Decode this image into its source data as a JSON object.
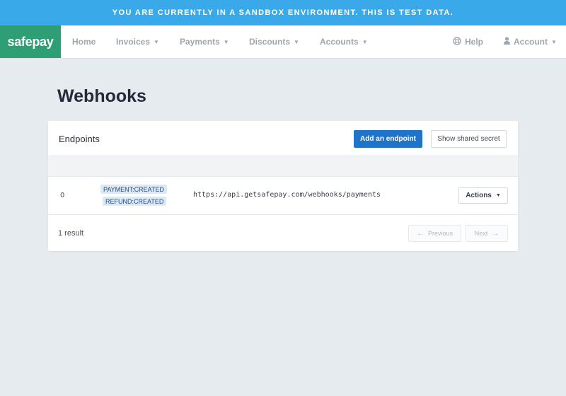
{
  "banner": {
    "text": "YOU ARE CURRENTLY IN A SANDBOX ENVIRONMENT. THIS IS TEST DATA."
  },
  "nav": {
    "logo": "safepay",
    "items": [
      {
        "label": "Home"
      },
      {
        "label": "Invoices"
      },
      {
        "label": "Payments"
      },
      {
        "label": "Discounts"
      },
      {
        "label": "Accounts"
      }
    ],
    "help": "Help",
    "account": "Account"
  },
  "page": {
    "title": "Webhooks"
  },
  "endpoints": {
    "title": "Endpoints",
    "add_button": "Add an endpoint",
    "secret_button": "Show shared secret",
    "rows": [
      {
        "id": "0",
        "events": [
          "PAYMENT:CREATED",
          "REFUND:CREATED"
        ],
        "url": "https://api.getsafepay.com/webhooks/payments",
        "actions_label": "Actions"
      }
    ],
    "result_count": "1 result",
    "pagination": {
      "previous": "Previous",
      "next": "Next"
    }
  },
  "colors": {
    "banner": "#3aa9ea",
    "brand": "#2e9e74",
    "primary_button": "#1f74c9",
    "tag_background": "#dbe8f5"
  },
  "icons": {
    "help": "lifebuoy-icon",
    "account": "user-icon",
    "caret": "caret-down-icon",
    "previous": "arrow-left-icon",
    "next": "arrow-right-icon"
  }
}
